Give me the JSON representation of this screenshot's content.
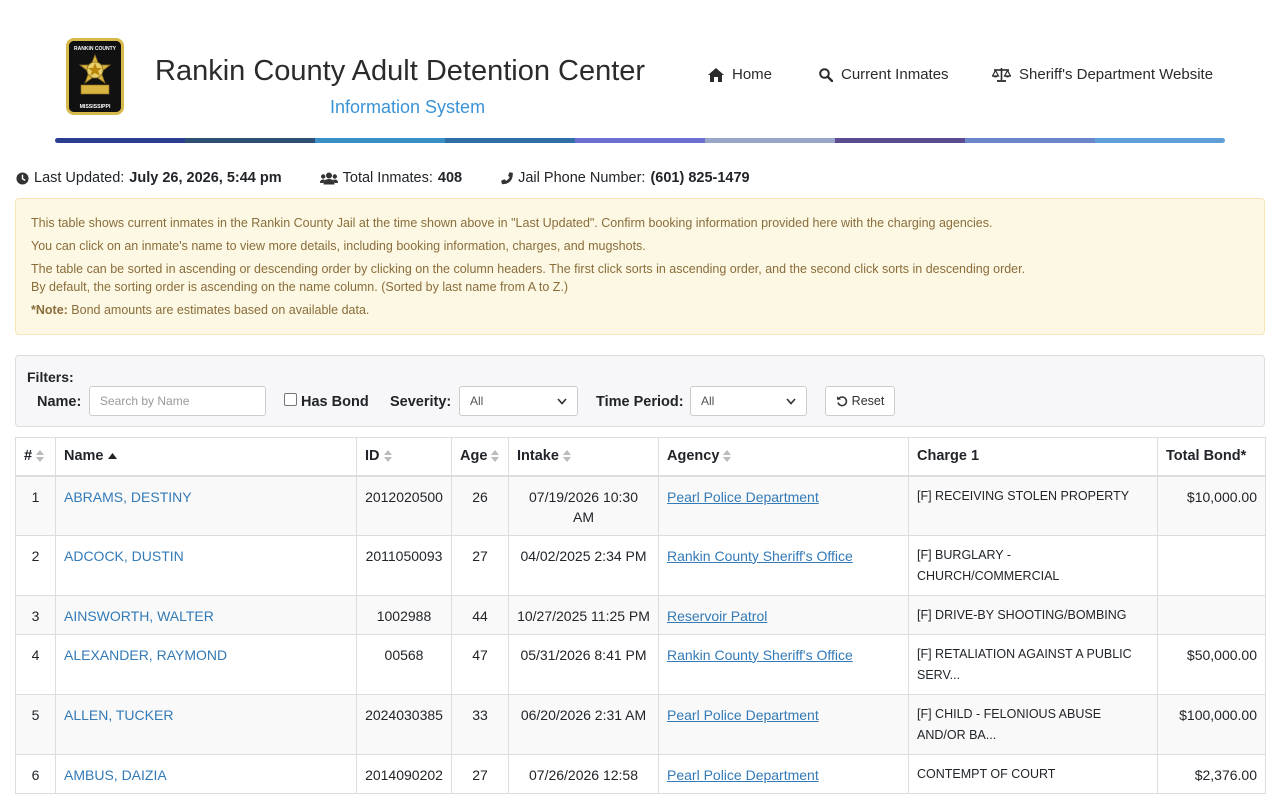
{
  "header": {
    "title": "Rankin County Adult Detention Center",
    "subtitle": "Information System",
    "logo_top_text": "RANKIN COUNTY",
    "logo_bottom_text": "MISSISSIPPI",
    "nav": [
      {
        "label": "Home",
        "icon": "home-icon"
      },
      {
        "label": "Current Inmates",
        "icon": "search-icon"
      },
      {
        "label": "Sheriff's Department Website",
        "icon": "balance-scale-icon"
      }
    ],
    "bar_colors": [
      "#2c3e90",
      "#2d4f73",
      "#3a8fc6",
      "#2f6fa6",
      "#6b6fd0",
      "#9aa6c7",
      "#5b4c92",
      "#6b86c9",
      "#5fa0d8"
    ]
  },
  "info": {
    "last_updated_label": "Last Updated:",
    "last_updated_value": "July 26, 2026, 5:44 pm",
    "total_label": "Total Inmates:",
    "total_value": "408",
    "phone_label": "Jail Phone Number:",
    "phone_value": "(601) 825-1479"
  },
  "alert": {
    "line1": "This table shows current inmates in the Rankin County Jail at the time shown above in \"Last Updated\". Confirm booking information provided here with the charging agencies.",
    "line2": "You can click on an inmate's name to view more details, including booking information, charges, and mugshots.",
    "line3a": "The table can be sorted in ascending or descending order by clicking on the column headers. The first click sorts in ascending order, and the second click sorts in descending order.",
    "line3b": "By default, the sorting order is ascending on the name column. (Sorted by last name from A to Z.)",
    "note_label": "*Note:",
    "note_text": " Bond amounts are estimates based on available data."
  },
  "filters": {
    "title": "Filters:",
    "name_label": "Name:",
    "name_placeholder": "Search by Name",
    "has_bond_label": "Has Bond",
    "severity_label": "Severity:",
    "severity_value": "All",
    "time_label": "Time Period:",
    "time_value": "All",
    "reset_label": "Reset"
  },
  "table": {
    "columns": {
      "num": "#",
      "name": "Name",
      "id": "ID",
      "age": "Age",
      "intake": "Intake",
      "agency": "Agency",
      "charge": "Charge 1",
      "bond": "Total Bond*"
    },
    "rows": [
      {
        "num": "1",
        "name": "ABRAMS, DESTINY",
        "id": "2012020500",
        "age": "26",
        "intake": "07/19/2026 10:30 AM",
        "agency": "Pearl Police Department",
        "charge": "[F] RECEIVING STOLEN PROPERTY",
        "bond": "$10,000.00"
      },
      {
        "num": "2",
        "name": "ADCOCK, DUSTIN",
        "id": "2011050093",
        "age": "27",
        "intake": "04/02/2025 2:34 PM",
        "agency": "Rankin County Sheriff's Office",
        "charge": "[F] BURGLARY - CHURCH/COMMERCIAL",
        "bond": ""
      },
      {
        "num": "3",
        "name": "AINSWORTH, WALTER",
        "id": "1002988",
        "age": "44",
        "intake": "10/27/2025 11:25 PM",
        "agency": "Reservoir Patrol",
        "charge": "[F] DRIVE-BY SHOOTING/BOMBING",
        "bond": ""
      },
      {
        "num": "4",
        "name": "ALEXANDER, RAYMOND",
        "id": "00568",
        "age": "47",
        "intake": "05/31/2026 8:41 PM",
        "agency": "Rankin County Sheriff's Office",
        "charge": "[F] RETALIATION AGAINST A PUBLIC SERV...",
        "bond": "$50,000.00"
      },
      {
        "num": "5",
        "name": "ALLEN, TUCKER",
        "id": "2024030385",
        "age": "33",
        "intake": "06/20/2026 2:31 AM",
        "agency": "Pearl Police Department",
        "charge": "[F] CHILD - FELONIOUS ABUSE AND/OR BA...",
        "bond": "$100,000.00"
      },
      {
        "num": "6",
        "name": "AMBUS, DAIZIA",
        "id": "2014090202",
        "age": "27",
        "intake": "07/26/2026 12:58",
        "agency": "Pearl Police Department",
        "charge": "CONTEMPT OF COURT",
        "bond": "$2,376.00"
      }
    ]
  }
}
